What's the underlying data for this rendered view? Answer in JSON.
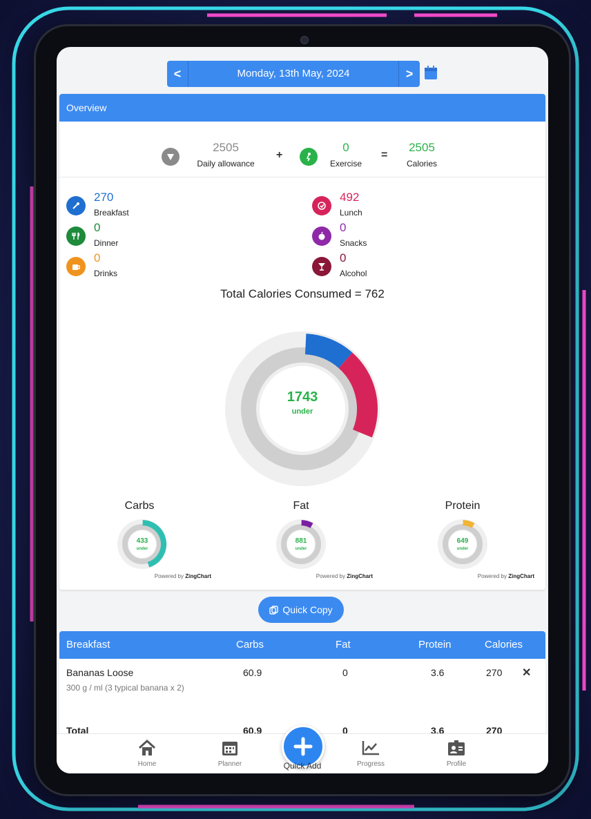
{
  "date_nav": {
    "prev_label": "<",
    "date": "Monday, 13th May, 2024",
    "next_label": ">"
  },
  "overview": {
    "title": "Overview",
    "allowance_value": "2505",
    "allowance_label": "Daily allowance",
    "plus": "+",
    "exercise_value": "0",
    "exercise_label": "Exercise",
    "equals": "=",
    "calories_value": "2505",
    "calories_label": "Calories"
  },
  "meals": [
    {
      "value": "270",
      "label": "Breakfast",
      "color": "#1f6fd1"
    },
    {
      "value": "492",
      "label": "Lunch",
      "color": "#d6245b"
    },
    {
      "value": "0",
      "label": "Dinner",
      "color": "#1e8a3b"
    },
    {
      "value": "0",
      "label": "Snacks",
      "color": "#8e2aa8"
    },
    {
      "value": "0",
      "label": "Drinks",
      "color": "#f0931e"
    },
    {
      "value": "0",
      "label": "Alcohol",
      "color": "#8a1638"
    }
  ],
  "total_consumed": {
    "label": "Total Calories Consumed =",
    "value": "762"
  },
  "chart_data": [
    {
      "type": "pie",
      "subtype": "donut",
      "center_value": "1743",
      "center_label": "under",
      "total": 2505,
      "series": [
        {
          "name": "Breakfast",
          "value": 270,
          "color": "#1f6fd1"
        },
        {
          "name": "Lunch",
          "value": 492,
          "color": "#d6245b"
        }
      ],
      "remaining_value": 1743
    },
    {
      "type": "pie",
      "subtype": "donut",
      "title": "Carbs",
      "center_value": "433",
      "center_label": "under",
      "fraction": 0.45,
      "color": "#2fbfb2"
    },
    {
      "type": "pie",
      "subtype": "donut",
      "title": "Fat",
      "center_value": "881",
      "center_label": "under",
      "fraction": 0.08,
      "color": "#7a1fa2"
    },
    {
      "type": "pie",
      "subtype": "donut",
      "title": "Protein",
      "center_value": "649",
      "center_label": "under",
      "fraction": 0.08,
      "color": "#f2b336"
    }
  ],
  "powered_by": {
    "prefix": "Powered by",
    "brand": "ZingChart"
  },
  "quick_copy_label": "Quick Copy",
  "table": {
    "headers": [
      "Breakfast",
      "Carbs",
      "Fat",
      "Protein",
      "Calories"
    ],
    "rows": [
      {
        "name": "Bananas Loose",
        "detail": "300 g / ml (3 typical banana x 2)",
        "carbs": "60.9",
        "fat": "0",
        "protein": "3.6",
        "calories": "270",
        "remove": "✕"
      }
    ],
    "total": {
      "label": "Total",
      "carbs": "60.9",
      "fat": "0",
      "protein": "3.6",
      "calories": "270"
    }
  },
  "bottom_nav": {
    "home": "Home",
    "planner": "Planner",
    "quick_add": "Quick Add",
    "progress": "Progress",
    "profile": "Profile"
  },
  "colors": {
    "accent": "#3b8af0",
    "green": "#2ab24a",
    "neon_cyan": "#3ef2ff",
    "neon_pink": "#ff4fd8"
  }
}
